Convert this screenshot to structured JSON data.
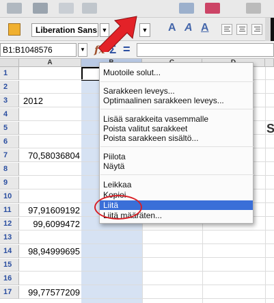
{
  "toolbar": {
    "font_name": "Liberation Sans",
    "bold_label": "A",
    "italic_label": "A",
    "underline_label": "A"
  },
  "formula_bar": {
    "name_box": "B1:B1048576",
    "fx": "fx",
    "sum": "Σ",
    "eq": "="
  },
  "grid": {
    "columns": [
      "A",
      "B",
      "C",
      "D"
    ],
    "rows": [
      {
        "n": "1",
        "a": ""
      },
      {
        "n": "2",
        "a": ""
      },
      {
        "n": "3",
        "a": "2012"
      },
      {
        "n": "4",
        "a": ""
      },
      {
        "n": "5",
        "a": ""
      },
      {
        "n": "6",
        "a": ""
      },
      {
        "n": "7",
        "a": "70,58036804"
      },
      {
        "n": "8",
        "a": ""
      },
      {
        "n": "9",
        "a": ""
      },
      {
        "n": "10",
        "a": ""
      },
      {
        "n": "11",
        "a": "97,91609192"
      },
      {
        "n": "12",
        "a": "99,6099472"
      },
      {
        "n": "13",
        "a": ""
      },
      {
        "n": "14",
        "a": "98,94999695"
      },
      {
        "n": "15",
        "a": ""
      },
      {
        "n": "16",
        "a": ""
      },
      {
        "n": "17",
        "a": "99,77577209"
      }
    ],
    "partial_text": "S"
  },
  "context_menu": {
    "format_cells": "Muotoile solut...",
    "column_width": "Sarakkeen leveys...",
    "optimal_width": "Optimaalinen sarakkeen leveys...",
    "insert_left": "Lisää sarakkeita vasemmalle",
    "delete_cols": "Poista valitut sarakkeet",
    "delete_contents": "Poista sarakkeen sisältö...",
    "hide": "Piilota",
    "show": "Näytä",
    "cut": "Leikkaa",
    "copy": "Kopioi",
    "paste": "Liitä",
    "paste_special": "Liitä määräten..."
  },
  "colors": {
    "highlight": "#3a6fd8",
    "selected_column": "#d6e2f3",
    "annotation_red": "#d81f26"
  }
}
